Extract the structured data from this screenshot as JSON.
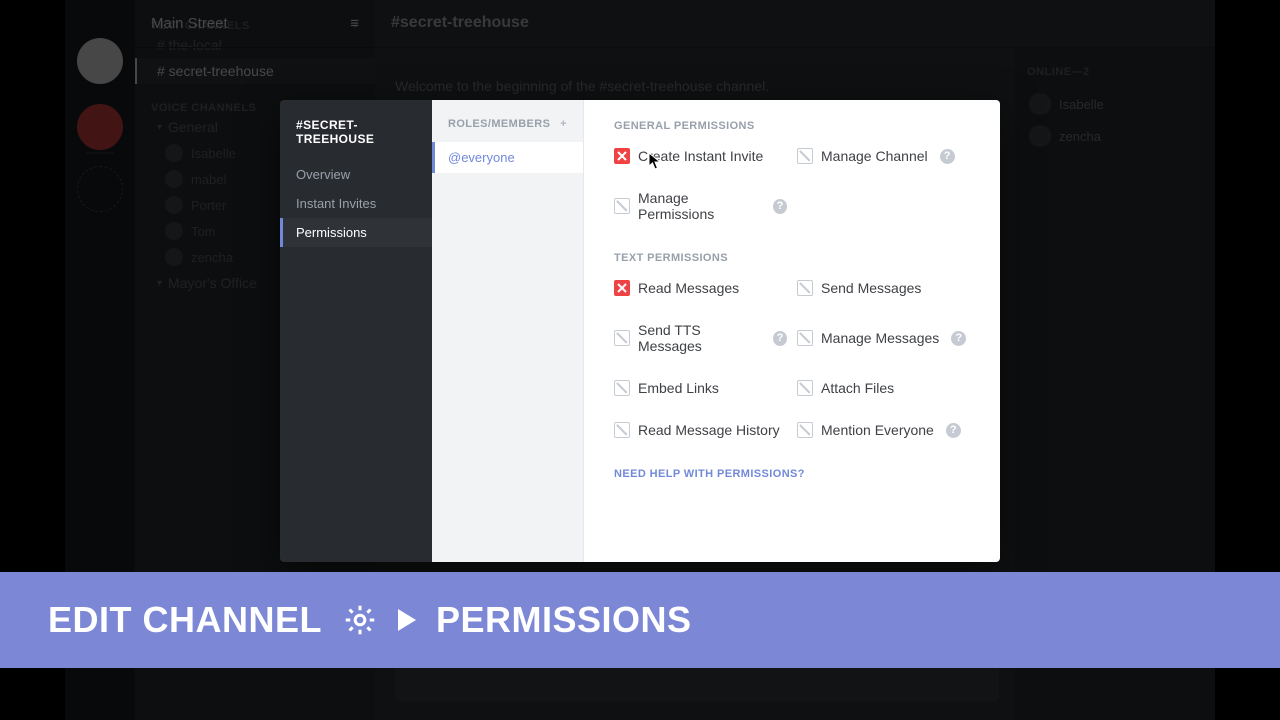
{
  "traffic_lights": {
    "close": "close",
    "min": "minimize",
    "max": "maximize"
  },
  "server": {
    "name": "Main Street"
  },
  "sidebar": {
    "text_header": "TEXT CHANNELS",
    "text_channels": [
      {
        "name": "the-local",
        "display": "# the-local"
      },
      {
        "name": "secret-treehouse",
        "display": "# secret-treehouse",
        "active": true
      }
    ],
    "voice_header": "VOICE CHANNELS",
    "voice_channels": [
      {
        "name": "General",
        "expanded": true,
        "members": [
          "Isabelle",
          "mabel",
          "Porter",
          "Tom",
          "zencha"
        ]
      },
      {
        "name": "Mayor's Office",
        "expanded": false
      }
    ]
  },
  "channel_header": "#secret-treehouse",
  "welcome_text": "Welcome to the beginning of the #secret-treehouse channel.",
  "members_panel": {
    "header": "ONLINE—2",
    "members": [
      "Isabelle",
      "zencha"
    ]
  },
  "settings": {
    "title": "#SECRET-TREEHOUSE",
    "nav": [
      {
        "label": "Overview"
      },
      {
        "label": "Instant Invites"
      },
      {
        "label": "Permissions",
        "active": true
      }
    ],
    "roles_header": "ROLES/MEMBERS",
    "roles": [
      {
        "label": "@everyone",
        "active": true
      }
    ],
    "sections": {
      "general": {
        "title": "GENERAL PERMISSIONS",
        "perms": {
          "create_invite": {
            "label": "Create Instant Invite",
            "state": "denied"
          },
          "manage_channel": {
            "label": "Manage Channel",
            "state": "neutral",
            "help": true
          },
          "manage_permissions": {
            "label": "Manage Permissions",
            "state": "neutral",
            "help": true
          }
        }
      },
      "text": {
        "title": "TEXT PERMISSIONS",
        "perms": {
          "read_messages": {
            "label": "Read Messages",
            "state": "denied"
          },
          "send_messages": {
            "label": "Send Messages",
            "state": "neutral"
          },
          "send_tts": {
            "label": "Send TTS Messages",
            "state": "neutral",
            "help": true
          },
          "manage_messages": {
            "label": "Manage Messages",
            "state": "neutral",
            "help": true
          },
          "embed_links": {
            "label": "Embed Links",
            "state": "neutral"
          },
          "attach_files": {
            "label": "Attach Files",
            "state": "neutral"
          },
          "read_history": {
            "label": "Read Message History",
            "state": "neutral"
          },
          "mention_everyone": {
            "label": "Mention Everyone",
            "state": "neutral",
            "help": true
          }
        }
      }
    },
    "help_link": "NEED HELP WITH PERMISSIONS?"
  },
  "banner": {
    "left": "EDIT CHANNEL",
    "right": "PERMISSIONS"
  }
}
